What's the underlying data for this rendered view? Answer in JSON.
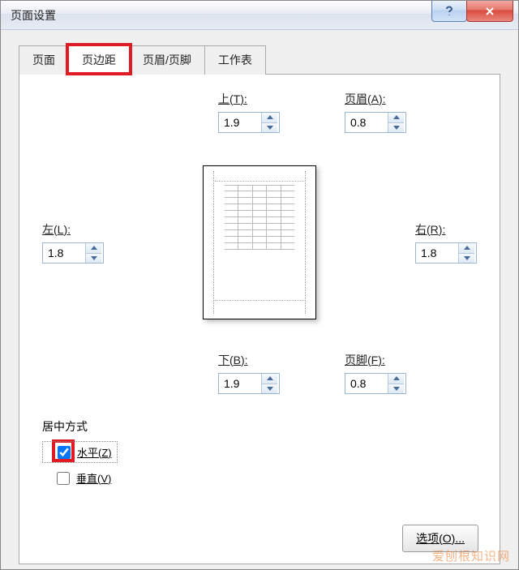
{
  "window": {
    "title": "页面设置"
  },
  "tabs": [
    {
      "label": "页面"
    },
    {
      "label": "页边距"
    },
    {
      "label": "页眉/页脚"
    },
    {
      "label": "工作表"
    }
  ],
  "margins": {
    "top": {
      "label": "上(",
      "accel": "T",
      "suffix": "):",
      "value": "1.9"
    },
    "header": {
      "label": "页眉(",
      "accel": "A",
      "suffix": "):",
      "value": "0.8"
    },
    "left": {
      "label": "左(",
      "accel": "L",
      "suffix": "):",
      "value": "1.8"
    },
    "right": {
      "label": "右(",
      "accel": "R",
      "suffix": "):",
      "value": "1.8"
    },
    "bottom": {
      "label": "下(",
      "accel": "B",
      "suffix": "):",
      "value": "1.9"
    },
    "footer": {
      "label": "页脚(",
      "accel": "F",
      "suffix": "):",
      "value": "0.8"
    }
  },
  "center": {
    "section_label": "居中方式",
    "horizontal": {
      "label": "水平(",
      "accel": "Z",
      "suffix": ")",
      "checked": true
    },
    "vertical": {
      "label": "垂直(",
      "accel": "V",
      "suffix": ")",
      "checked": false
    }
  },
  "buttons": {
    "options": {
      "label": "选项(",
      "accel": "O",
      "suffix": ")..."
    }
  },
  "watermark": "爱刨根知识网"
}
